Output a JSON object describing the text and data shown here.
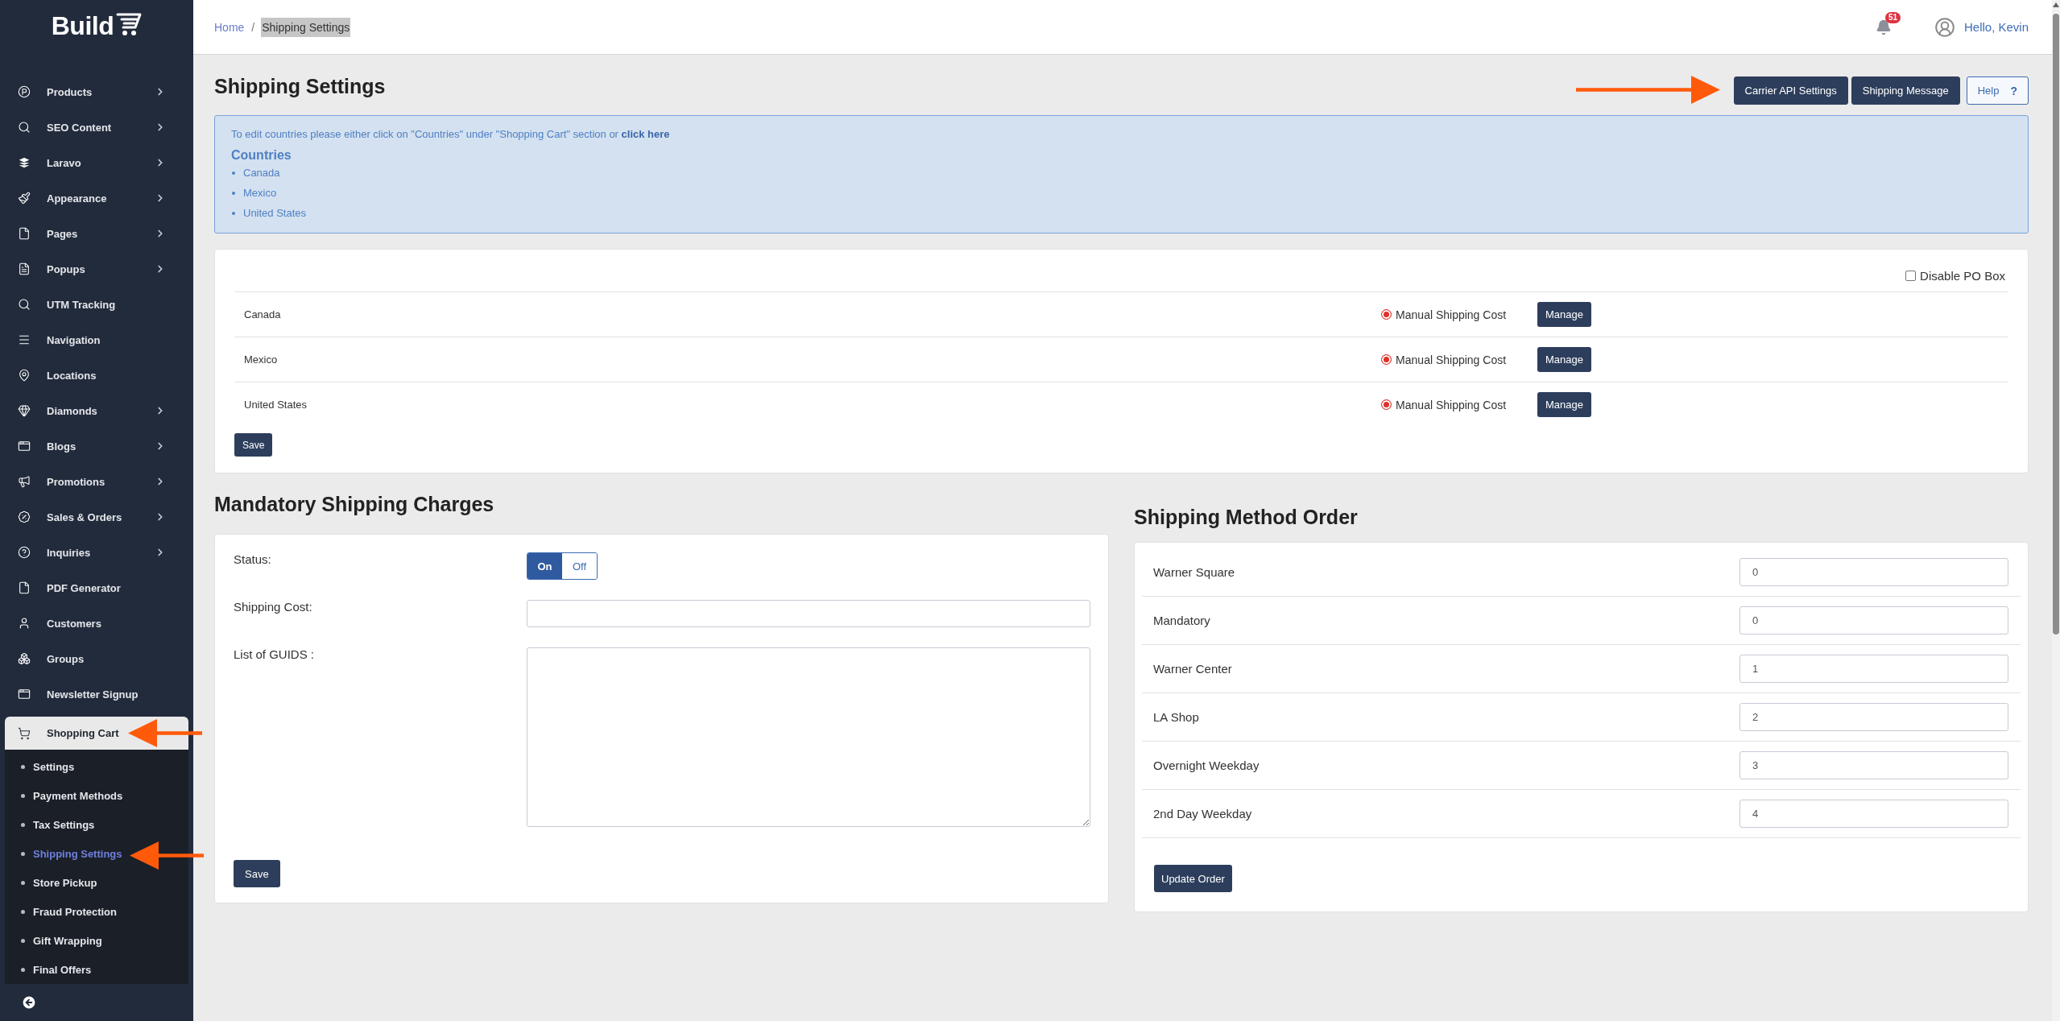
{
  "sidebar": {
    "logo": "Build",
    "items": [
      {
        "label": "Products",
        "kind": "group",
        "expanded": false
      },
      {
        "label": "SEO Content",
        "kind": "group",
        "expanded": false
      },
      {
        "label": "Laravo",
        "kind": "group",
        "expanded": false
      },
      {
        "label": "Appearance",
        "kind": "group",
        "expanded": false
      },
      {
        "label": "Pages",
        "kind": "group",
        "expanded": false
      },
      {
        "label": "Popups",
        "kind": "group",
        "expanded": false
      },
      {
        "label": "UTM Tracking",
        "kind": "link",
        "expanded": false
      },
      {
        "label": "Navigation",
        "kind": "link",
        "expanded": false
      },
      {
        "label": "Locations",
        "kind": "link",
        "expanded": false
      },
      {
        "label": "Diamonds",
        "kind": "group",
        "expanded": false
      },
      {
        "label": "Blogs",
        "kind": "group",
        "expanded": false
      },
      {
        "label": "Promotions",
        "kind": "group",
        "expanded": false
      },
      {
        "label": "Sales & Orders",
        "kind": "group",
        "expanded": false
      },
      {
        "label": "Inquiries",
        "kind": "group",
        "expanded": false
      },
      {
        "label": "PDF Generator",
        "kind": "link",
        "expanded": false
      },
      {
        "label": "Customers",
        "kind": "link",
        "expanded": false
      },
      {
        "label": "Groups",
        "kind": "link",
        "expanded": false
      },
      {
        "label": "Newsletter Signup",
        "kind": "link",
        "expanded": false
      },
      {
        "label": "Shopping Cart",
        "kind": "group",
        "expanded": true,
        "children": [
          {
            "label": "Settings",
            "selected": false
          },
          {
            "label": "Payment Methods",
            "selected": false
          },
          {
            "label": "Tax Settings",
            "selected": false
          },
          {
            "label": "Shipping Settings",
            "selected": true
          },
          {
            "label": "Store Pickup",
            "selected": false
          },
          {
            "label": "Fraud Protection",
            "selected": false
          },
          {
            "label": "Gift Wrapping",
            "selected": false
          },
          {
            "label": "Final Offers",
            "selected": false
          }
        ]
      }
    ]
  },
  "header": {
    "breadcrumb": [
      {
        "label": "Home",
        "current": false
      },
      {
        "label": "Shipping Settings",
        "current": true
      }
    ],
    "separator": "/",
    "notifications": "51",
    "greeting": "Hello, Kevin"
  },
  "page": {
    "title": "Shipping Settings",
    "actions": [
      {
        "label": "Carrier API Settings",
        "kind": "primary"
      },
      {
        "label": "Shipping Message",
        "kind": "primary"
      },
      {
        "label": "Help",
        "kind": "outline",
        "glyph": "?"
      }
    ]
  },
  "info": {
    "message": "To edit countries please either click on \"Countries\" under \"Shopping Cart\" section or",
    "link": "click here",
    "heading": "Countries",
    "countries": [
      "Canada",
      "Mexico",
      "United States"
    ]
  },
  "countries_card": {
    "po_box": {
      "label": "Disable PO Box",
      "checked": false
    },
    "rows": [
      {
        "country": "Canada",
        "option": "Manual Shipping Cost",
        "checked": true,
        "button": "Manage"
      },
      {
        "country": "Mexico",
        "option": "Manual Shipping Cost",
        "checked": true,
        "button": "Manage"
      },
      {
        "country": "United States",
        "option": "Manual Shipping Cost",
        "checked": true,
        "button": "Manage"
      }
    ],
    "save": "Save"
  },
  "mandatory": {
    "title": "Mandatory Shipping Charges",
    "status": {
      "label": "Status:",
      "options": [
        {
          "label": "On",
          "selected": true
        },
        {
          "label": "Off",
          "selected": false
        }
      ]
    },
    "shipping_cost": {
      "label": "Shipping Cost:"
    },
    "guids": {
      "label": "List of GUIDS :"
    },
    "save": "Save"
  },
  "method_order": {
    "title": "Shipping Method Order",
    "rows": [
      {
        "label": "Warner Square",
        "value": "0"
      },
      {
        "label": "Mandatory",
        "value": "0"
      },
      {
        "label": "Warner Center",
        "value": "1"
      },
      {
        "label": "LA Shop",
        "value": "2"
      },
      {
        "label": "Overnight Weekday",
        "value": "3"
      },
      {
        "label": "2nd Day Weekday",
        "value": "4"
      }
    ],
    "button": "Update Order"
  }
}
